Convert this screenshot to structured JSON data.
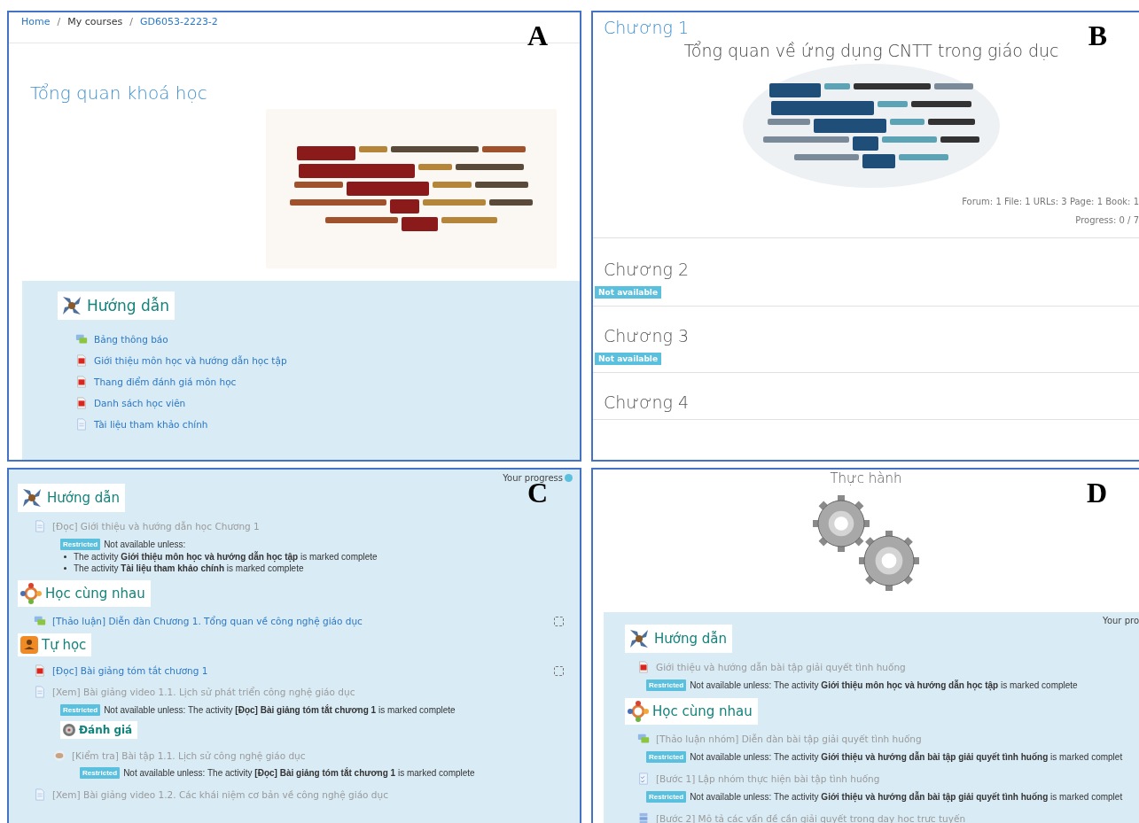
{
  "panels": [
    {
      "kind": "overview",
      "letter": "A",
      "breadcrumb": [
        {
          "label": "Home",
          "link": true
        },
        {
          "label": "My courses",
          "link": false
        },
        {
          "label": "GD6053-2223-2",
          "link": true
        }
      ],
      "breadcrumb_separator": "/",
      "title": "Tổng quan khoá học",
      "sections": [
        {
          "kind": "guide",
          "heading": "Hướng dẫn",
          "items": [
            {
              "kind": "forum",
              "title": "Bảng thông báo",
              "available": true
            },
            {
              "kind": "pdf",
              "title": "Giới thiệu môn học và hướng dẫn học tập",
              "available": true
            },
            {
              "kind": "pdf",
              "title": "Thang điểm đánh giá môn học",
              "available": true
            },
            {
              "kind": "pdf",
              "title": "Danh sách học viên",
              "available": true
            },
            {
              "kind": "page",
              "title": "Tài liệu tham khảo chính",
              "available": true
            }
          ]
        }
      ]
    },
    {
      "kind": "chapters",
      "letter": "B",
      "chapters": [
        {
          "title": "Chương 1",
          "available": true,
          "subtitle": "Tổng quan về ứng dụng CNTT trong giáo dục",
          "stats": "Forum: 1 File: 1 URLs: 3 Page: 1 Book: 1",
          "progress": "Progress: 0 / 7"
        },
        {
          "title": "Chương 2",
          "available": false,
          "badge": "Not available"
        },
        {
          "title": "Chương 3",
          "available": false,
          "badge": "Not available"
        },
        {
          "title": "Chương 4",
          "available": false
        }
      ]
    },
    {
      "kind": "sections",
      "letter": "C",
      "progress_label": "Your progress",
      "sections": [
        {
          "kind": "guide",
          "heading": "Hướng dẫn",
          "items": [
            {
              "kind": "page",
              "title": "[Đọc] Giới thiệu và hướng dẫn học Chương 1",
              "available": false,
              "restriction": {
                "badge": "Restricted",
                "text": "Not available unless:",
                "bullets": [
                  "The activity **Giới thiệu môn học và hướng dẫn học tập** is marked complete",
                  "The activity **Tài liệu tham khảo chính** is marked complete"
                ]
              }
            }
          ]
        },
        {
          "kind": "group",
          "heading": "Học cùng nhau",
          "items": [
            {
              "kind": "forum",
              "title": "[Thảo luận] Diễn đàn Chương 1. Tổng quan về công nghệ giáo dục",
              "available": true,
              "completed": false
            }
          ]
        },
        {
          "kind": "self",
          "heading": "Tự học",
          "items": [
            {
              "kind": "pdf",
              "title": "[Đọc] Bài giảng tóm tắt chương 1",
              "available": true,
              "completed": false
            },
            {
              "kind": "page",
              "title": "[Xem] Bài giảng video 1.1. Lịch sử phát triển công nghệ giáo dục",
              "available": false,
              "restriction": {
                "badge": "Restricted",
                "text": "Not available unless: The activity **[Đọc] Bài giảng tóm tắt chương 1** is marked complete"
              }
            },
            {
              "kind": "subheading",
              "heading": "Đánh giá",
              "children": [
                {
                  "kind": "quiz",
                  "title": "[Kiểm tra] Bài tập 1.1. Lịch sử công nghệ giáo dục",
                  "available": false,
                  "restriction": {
                    "badge": "Restricted",
                    "text": "Not available unless: The activity **[Đọc] Bài giảng tóm tắt chương 1** is marked complete"
                  }
                }
              ]
            },
            {
              "kind": "page",
              "title": "[Xem] Bài giảng video 1.2. Các khái niệm cơ bản về công nghệ giáo dục",
              "available": false
            }
          ]
        }
      ]
    },
    {
      "kind": "practice",
      "letter": "D",
      "title": "Thực hành",
      "progress_label": "Your pro",
      "sections": [
        {
          "kind": "guide",
          "heading": "Hướng dẫn",
          "items": [
            {
              "kind": "pdf",
              "title": "Giới thiệu và hướng dẫn bài tập giải quyết tình huống",
              "available": false,
              "restriction": {
                "badge": "Restricted",
                "text": "Not available unless: The activity **Giới thiệu môn học và hướng dẫn học tập** is marked complete"
              }
            }
          ]
        },
        {
          "kind": "group",
          "heading": "Học cùng nhau",
          "items": [
            {
              "kind": "forum",
              "title": "[Thảo luận nhóm] Diễn đàn bài tập giải quyết tình huống",
              "available": false,
              "restriction": {
                "badge": "Restricted",
                "text": "Not available unless: The activity **Giới thiệu và hướng dẫn bài tập giải quyết tình huống** is marked complet"
              }
            },
            {
              "kind": "assign",
              "title": "[Bước 1] Lập nhóm thực hiện bài tập tình huống",
              "available": false,
              "restriction": {
                "badge": "Restricted",
                "text": "Not available unless: The activity **Giới thiệu và hướng dẫn bài tập giải quyết tình huống** is marked complet"
              }
            },
            {
              "kind": "book",
              "title": "[Bước 2] Mô tả các vấn đề cần giải quyết trong dạy học trực tuyến",
              "available": false
            }
          ]
        }
      ]
    }
  ]
}
